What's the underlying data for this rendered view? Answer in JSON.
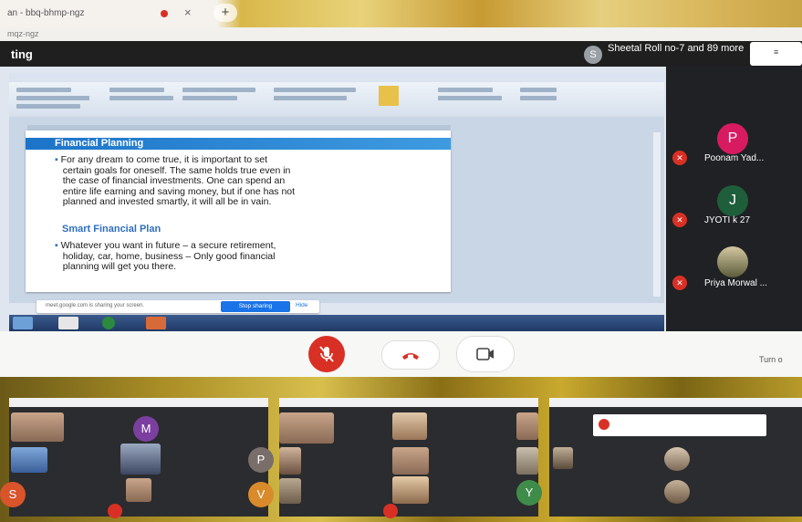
{
  "browser": {
    "tab_title": "an - bbq-bhmp-ngz",
    "new_tab_label": "+",
    "close_label": "×",
    "url": "mqz-ngz"
  },
  "meeting": {
    "title": "ting",
    "presenter_avatar": "S",
    "presenter_text": "Sheetal Roll no-7 and 89 more",
    "topright": "≡"
  },
  "slide": {
    "title": "Financial Planning",
    "bullet1_lines": [
      "For any dream to come true, it is important to set",
      "certain goals for oneself. The same holds true even in",
      "the case of financial investments. One can spend an",
      "entire life earning and saving money, but if one has not",
      "planned and invested smartly, it will all be in vain."
    ],
    "subtitle": "Smart Financial Plan",
    "bullet2_lines": [
      "Whatever you want in future – a secure retirement,",
      "holiday, car, home, business – Only good financial",
      "planning will get you there."
    ]
  },
  "share_bar": {
    "text": "meet.google.com is sharing your screen.",
    "stop_label": "Stop sharing",
    "hide_label": "Hide"
  },
  "participants": [
    {
      "initial": "P",
      "name": "Poonam Yad...",
      "color": "#d81b60"
    },
    {
      "initial": "J",
      "name": "JYOTI k 27",
      "color": "#1e5e3a"
    },
    {
      "initial": "",
      "name": "Priya Morwal ...",
      "color": "#6b6b4a"
    }
  ],
  "controls": {
    "mute_icon": "mic-off-icon",
    "end_icon": "call-end-icon",
    "camera_icon": "camera-icon",
    "turn_on_label": "Turn o"
  },
  "collage": {
    "left_avatars": [
      "M",
      "S",
      "P",
      "V"
    ],
    "mid_avatar": "Y"
  },
  "colors": {
    "red": "#d93025",
    "blue": "#1a73e8",
    "dark": "#202124"
  }
}
